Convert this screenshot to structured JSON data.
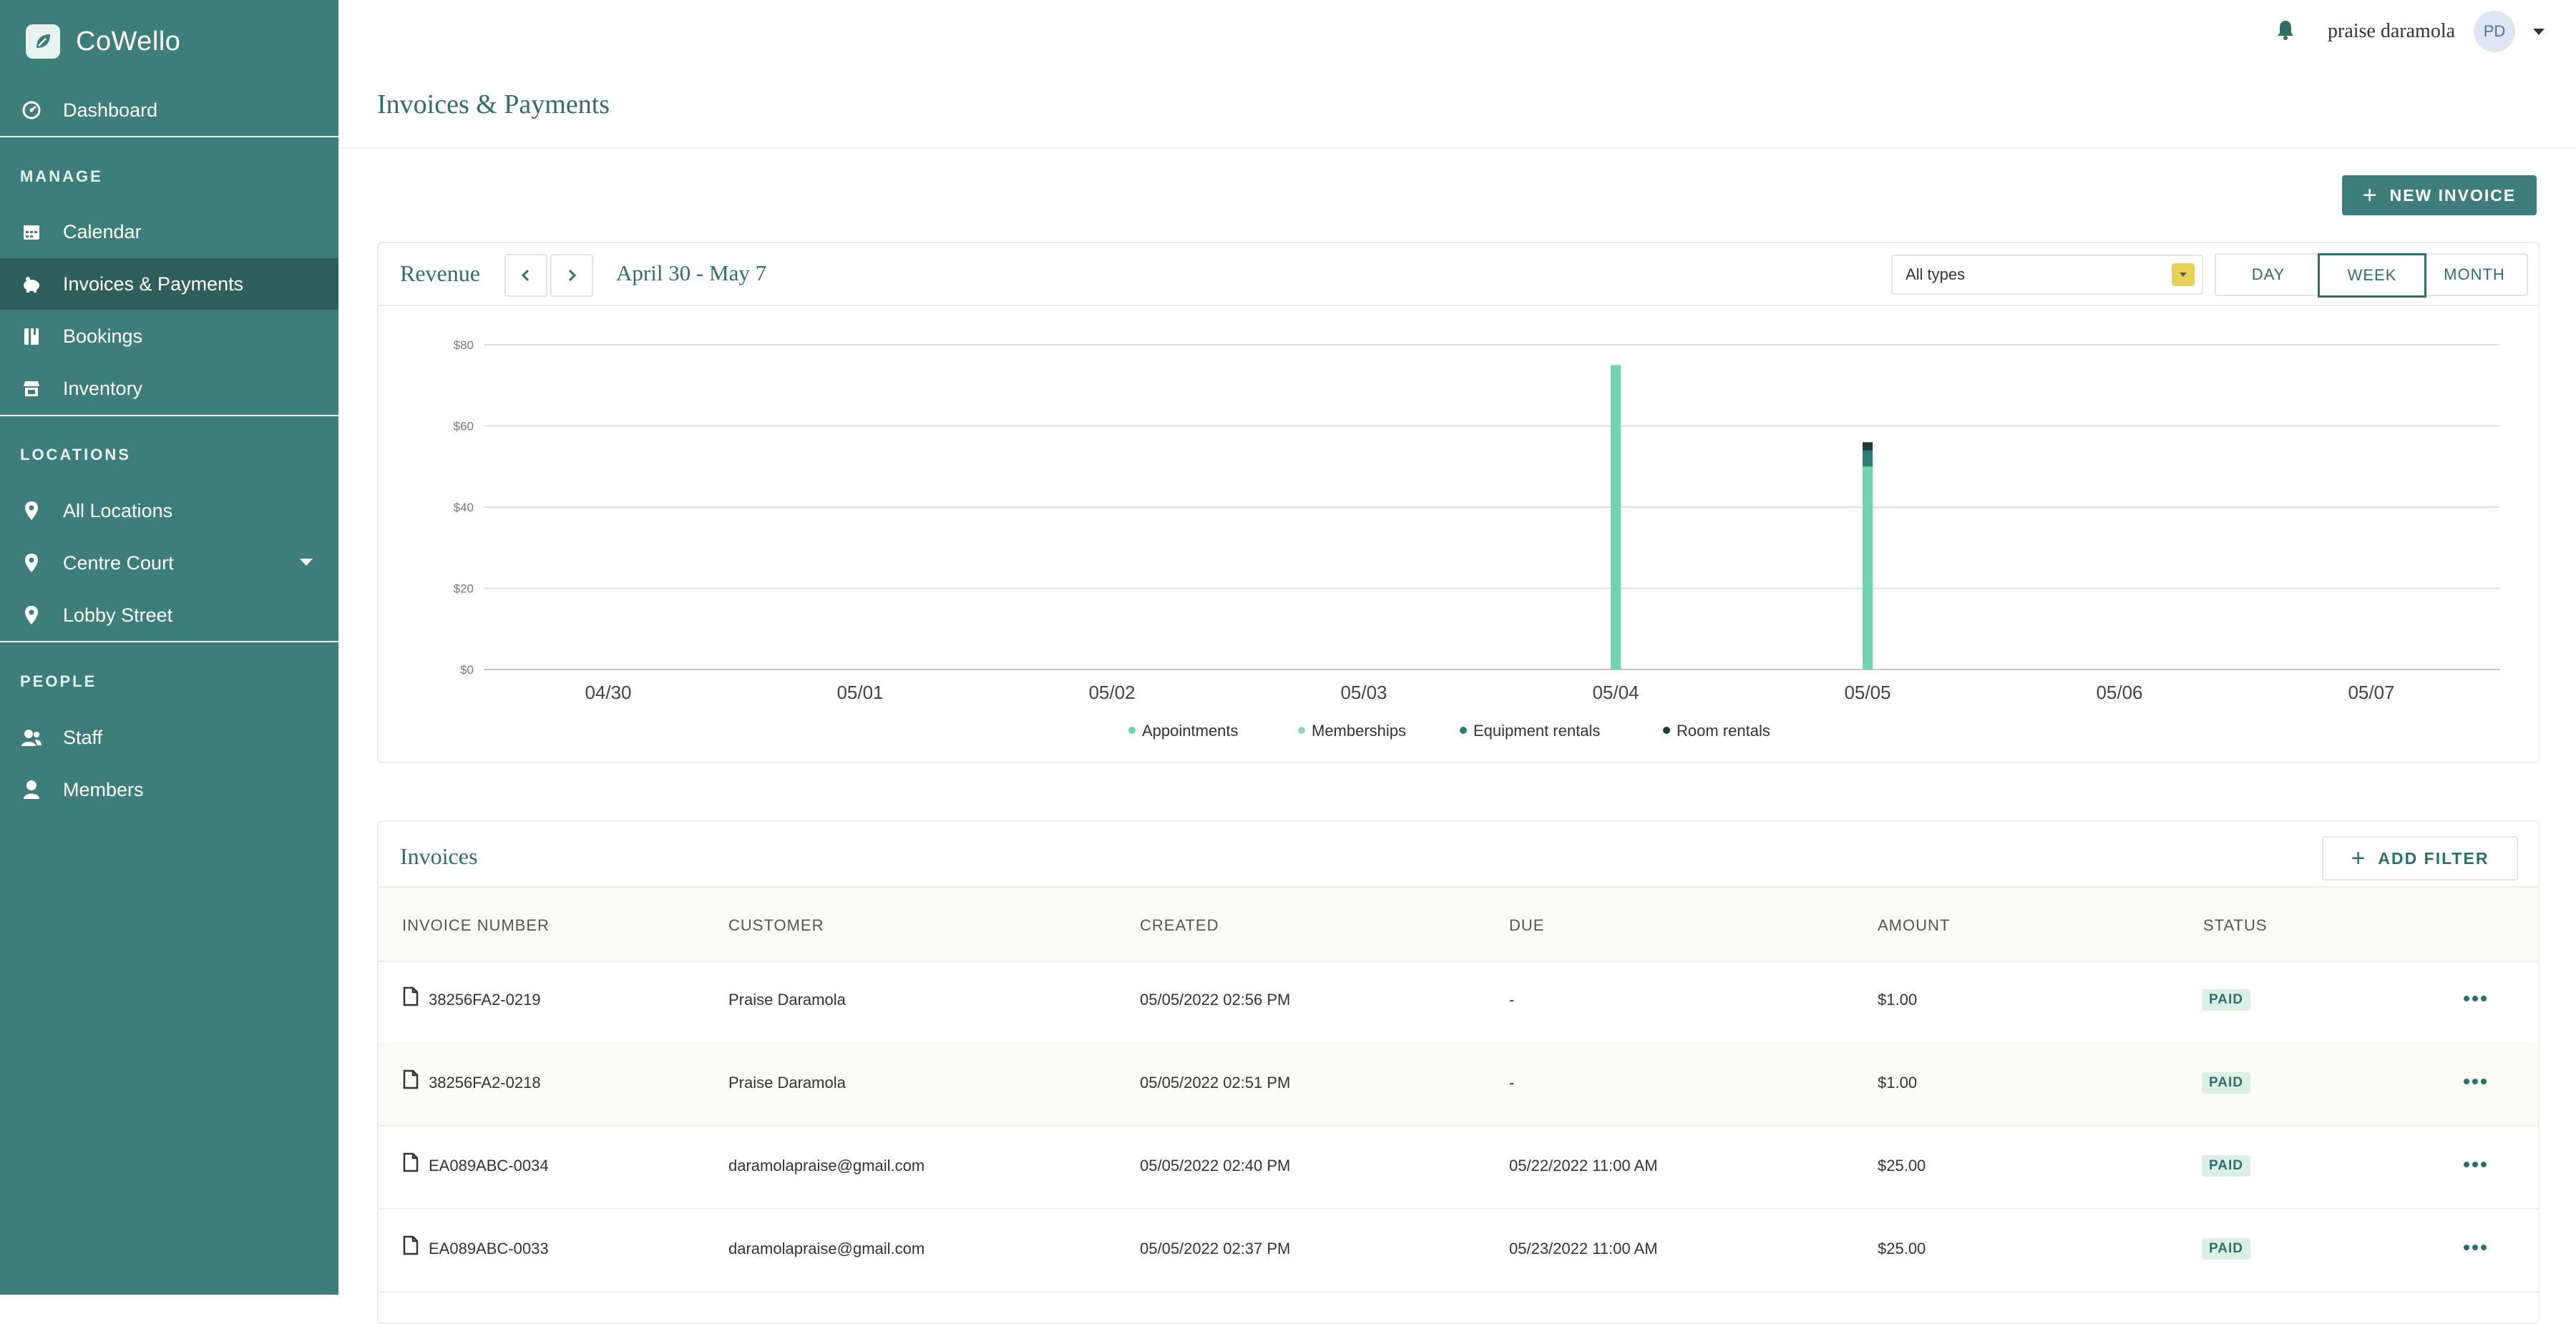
{
  "app": {
    "name": "CoWello"
  },
  "sidebar": {
    "dashboard": "Dashboard",
    "manage_title": "MANAGE",
    "manage": [
      "Calendar",
      "Invoices & Payments",
      "Bookings",
      "Inventory"
    ],
    "locations_title": "LOCATIONS",
    "locations": [
      "All Locations",
      "Centre Court",
      "Lobby Street"
    ],
    "people_title": "PEOPLE",
    "people": [
      "Staff",
      "Members"
    ],
    "active": "Invoices & Payments"
  },
  "header": {
    "user_name": "praise daramola",
    "user_initials": "PD",
    "page_title": "Invoices & Payments"
  },
  "actions": {
    "new_invoice": "NEW INVOICE"
  },
  "revenue": {
    "title": "Revenue",
    "date_range": "April 30 - May 7",
    "type_filter": "All types",
    "periods": [
      "DAY",
      "WEEK",
      "MONTH"
    ],
    "selected_period": "WEEK"
  },
  "chart_data": {
    "type": "bar",
    "stacked": true,
    "categories": [
      "04/30",
      "05/01",
      "05/02",
      "05/03",
      "05/04",
      "05/05",
      "05/06",
      "05/07"
    ],
    "y_ticks": [
      "$0",
      "$20",
      "$40",
      "$60",
      "$80"
    ],
    "ylim": [
      0,
      80
    ],
    "grid": true,
    "legend_position": "bottom",
    "series": [
      {
        "name": "Appointments",
        "color": "#6fd5b0",
        "values": [
          0,
          0,
          0,
          0,
          75,
          50,
          0,
          0
        ]
      },
      {
        "name": "Memberships",
        "color": "#8fd9bd",
        "values": [
          0,
          0,
          0,
          0,
          0,
          0,
          0,
          0
        ]
      },
      {
        "name": "Equipment rentals",
        "color": "#2b7f76",
        "values": [
          0,
          0,
          0,
          0,
          0,
          4,
          0,
          0
        ]
      },
      {
        "name": "Room rentals",
        "color": "#1f3b38",
        "values": [
          0,
          0,
          0,
          0,
          0,
          2,
          0,
          0
        ]
      }
    ]
  },
  "invoices": {
    "title": "Invoices",
    "add_filter": "ADD FILTER",
    "columns": [
      "INVOICE NUMBER",
      "CUSTOMER",
      "CREATED",
      "DUE",
      "AMOUNT",
      "STATUS"
    ],
    "rows": [
      {
        "number": "38256FA2-0219",
        "customer": "Praise Daramola",
        "created": "05/05/2022 02:56 PM",
        "due": "-",
        "amount": "$1.00",
        "status": "PAID"
      },
      {
        "number": "38256FA2-0218",
        "customer": "Praise Daramola",
        "created": "05/05/2022 02:51 PM",
        "due": "-",
        "amount": "$1.00",
        "status": "PAID"
      },
      {
        "number": "EA089ABC-0034",
        "customer": "daramolapraise@gmail.com",
        "created": "05/05/2022 02:40 PM",
        "due": "05/22/2022 11:00 AM",
        "amount": "$25.00",
        "status": "PAID"
      },
      {
        "number": "EA089ABC-0033",
        "customer": "daramolapraise@gmail.com",
        "created": "05/05/2022 02:37 PM",
        "due": "05/23/2022 11:00 AM",
        "amount": "$25.00",
        "status": "PAID"
      }
    ]
  },
  "colors": {
    "sidebar": "#3d7e7a",
    "sidebar_active": "#2f5f5c",
    "accent": "#2f6f6a",
    "paid_badge": "#dcefe4"
  },
  "icons": [
    "dashboard-icon",
    "calendar-icon",
    "piggy-bank-icon",
    "bookings-icon",
    "inventory-icon",
    "location-pin-icon",
    "staff-icon",
    "member-icon",
    "bell-icon",
    "document-icon",
    "more-icon"
  ]
}
